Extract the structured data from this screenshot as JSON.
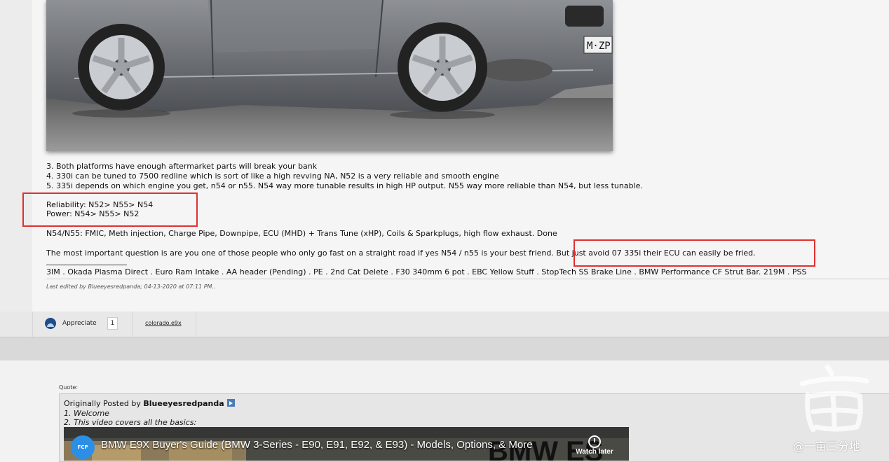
{
  "post": {
    "lines": [
      "3. Both platforms have enough aftermarket parts will break your bank",
      "4. 330i can be tuned to 7500 redline which is sort of like a high revving NA, N52 is a very reliable and smooth engine",
      "5. 335i depends on which engine you get, n54 or n55. N54 way more tunable results in high HP output. N55 way more reliable than N54, but less tunable.",
      "Reliability: N52> N55> N54",
      "Power: N54> N55> N52",
      "N54/N55: FMIC, Meth injection, Charge Pipe, Downpipe, ECU (MHD) + Trans Tune (xHP), Coils & Sparkplugs, high flow exhaust. Done",
      "The most important question is are you one of those people who only go fast on a straight road if yes N54 / n55 is your best friend. But just avoid 07 335i their ECU can easily be fried."
    ],
    "signature": "3IM . Okada Plasma Direct . Euro Ram Intake . AA header (Pending) . PE . 2nd Cat Delete . F30 340mm 6 pot . EBC Yellow Stuff . StopTech SS Brake Line . BMW Performance CF Strut Bar. 219M . PSS",
    "edited": "Last edited by Blueeyesredpanda; 04-13-2020 at 07:11 PM..",
    "image_plate": "M·ZP",
    "highlight_color": "#e03030"
  },
  "actions": {
    "appreciate_label": "Appreciate",
    "appreciate_count": "1",
    "user": "colorado.e9x"
  },
  "quote": {
    "label": "Quote:",
    "originally_posted_by": "Originally Posted by",
    "author": "Blueeyesredpanda",
    "lines": [
      "1. Welcome",
      "2. This video covers all the basics:"
    ]
  },
  "video": {
    "title": "BMW E9X Buyer's Guide (BMW 3-Series - E90, E91, E92, & E93) - Models, Options, & More",
    "channel_badge": "FCP Euro",
    "watch_later": "Watch later",
    "background_word": "BMW ES"
  },
  "watermark": {
    "text": "@一亩三分地"
  }
}
